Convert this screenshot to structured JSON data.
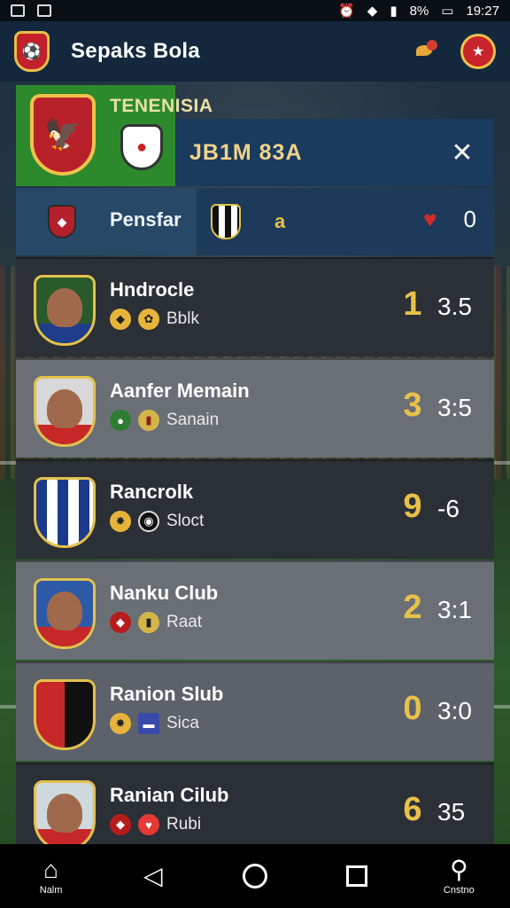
{
  "status_bar": {
    "time": "19:27",
    "battery": "8%"
  },
  "app_bar": {
    "title": "Sepaks Bola"
  },
  "feature": {
    "label": "TENENISIA",
    "score": "JB1M 83A"
  },
  "filter": {
    "label": "Pensfar",
    "letter": "a",
    "count": "0"
  },
  "rows": [
    {
      "name": "Hndrocle",
      "sub": "Bblk",
      "rank": "1",
      "score": "3.5"
    },
    {
      "name": "Aanfer Memain",
      "sub": "Sanain",
      "rank": "3",
      "score": "3:5"
    },
    {
      "name": "Rancrolk",
      "sub": "Sloct",
      "rank": "9",
      "score": "-6"
    },
    {
      "name": "Nanku Club",
      "sub": "Raat",
      "rank": "2",
      "score": "3:1"
    },
    {
      "name": "Ranion Slub",
      "sub": "Sica",
      "rank": "0",
      "score": "3:0"
    },
    {
      "name": "Ranian Cilub",
      "sub": "Rubi",
      "rank": "6",
      "score": "35"
    }
  ],
  "nav": {
    "home_label": "Nalm",
    "search_label": "Cnstno"
  }
}
